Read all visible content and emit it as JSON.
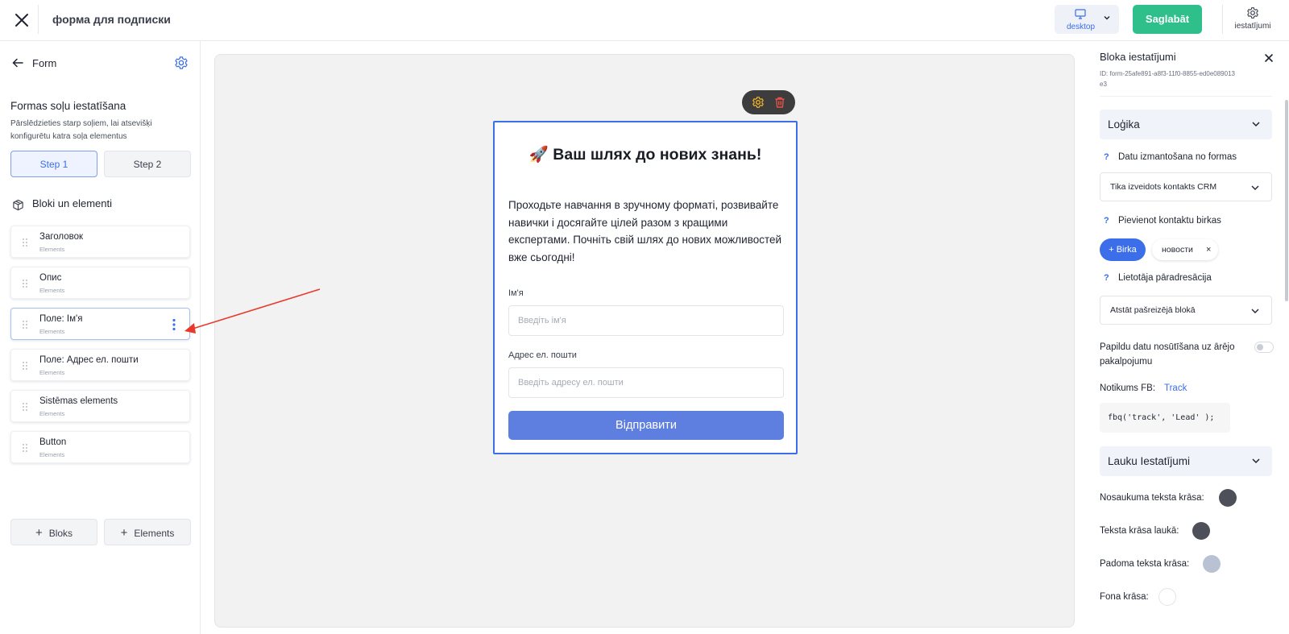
{
  "topbar": {
    "title": "форма для подписки",
    "device": "desktop",
    "save_label": "Saglabāt",
    "settings_label": "iestatījumi"
  },
  "left": {
    "back_label": "Form",
    "section_title": "Formas soļu iestatīšana",
    "section_desc": "Pārslēdzieties starp soļiem, lai atsevišķi konfigurētu katra soļa elementus",
    "steps": [
      "Step 1",
      "Step 2"
    ],
    "active_step": "Step 1",
    "blocks_title": "Bloki un elementi",
    "elements": [
      {
        "name": "Заголовок",
        "sub": "Elements"
      },
      {
        "name": "Опис",
        "sub": "Elements"
      },
      {
        "name": "Поле: Ім'я",
        "sub": "Elements"
      },
      {
        "name": "Поле: Адрес ел. пошти",
        "sub": "Elements"
      },
      {
        "name": "Sistēmas elements",
        "sub": "Elements"
      },
      {
        "name": "Button",
        "sub": "Elements"
      }
    ],
    "add_block_label": "Bloks",
    "add_element_label": "Elements"
  },
  "form": {
    "heading": "🚀 Ваш шлях до нових знань!",
    "description": "Проходьте навчання в зручному форматі, розвивайте навички і досягайте цілей разом з кращими експертами. Почніть свій шлях до нових можливостей вже сьогодні!",
    "name_label": "Ім'я",
    "name_placeholder": "Введіть ім'я",
    "email_label": "Адрес ел. пошти",
    "email_placeholder": "Введіть адресу ел. пошти",
    "submit_label": "Відправити"
  },
  "right": {
    "title": "Bloka iestatījumi",
    "block_id": "ID: form-25afe891-a8f3-11f0-8855-ed0e089013e3",
    "logic_title": "Loģika",
    "data_usage_label": "Datu izmantošana no formas",
    "data_usage_value": "Tika izveidots kontakts CRM",
    "tags_label": "Pievienot kontaktu birkas",
    "tag_button": "+ Birka",
    "tag_chip": "новости",
    "tag_remove": "×",
    "redirect_label": "Lietotāja pāradresācija",
    "redirect_value": "Atstāt pašreizējā blokā",
    "external_label": "Papildu datu nosūtīšana uz ārējo pakalpojumu",
    "external_enabled": false,
    "fb_label": "Notikums FB:",
    "fb_link": "Track",
    "fb_code": "fbq('track', 'Lead' );",
    "fields_title": "Lauku Iestatījumi",
    "colors": [
      {
        "label": "Nosaukuma teksta krāsa:",
        "color": "#4d5059"
      },
      {
        "label": "Teksta krāsa laukā:",
        "color": "#4d5059"
      },
      {
        "label": "Padoma teksta krāsa:",
        "color": "#b8c2d3"
      },
      {
        "label": "Fona krāsa:",
        "color": "#ffffff"
      }
    ]
  },
  "colors": {
    "accent": "#3b6ee8",
    "save": "#2fbf8a",
    "submit": "#5f7fe0",
    "annotation_arrow": "#e8392b"
  }
}
